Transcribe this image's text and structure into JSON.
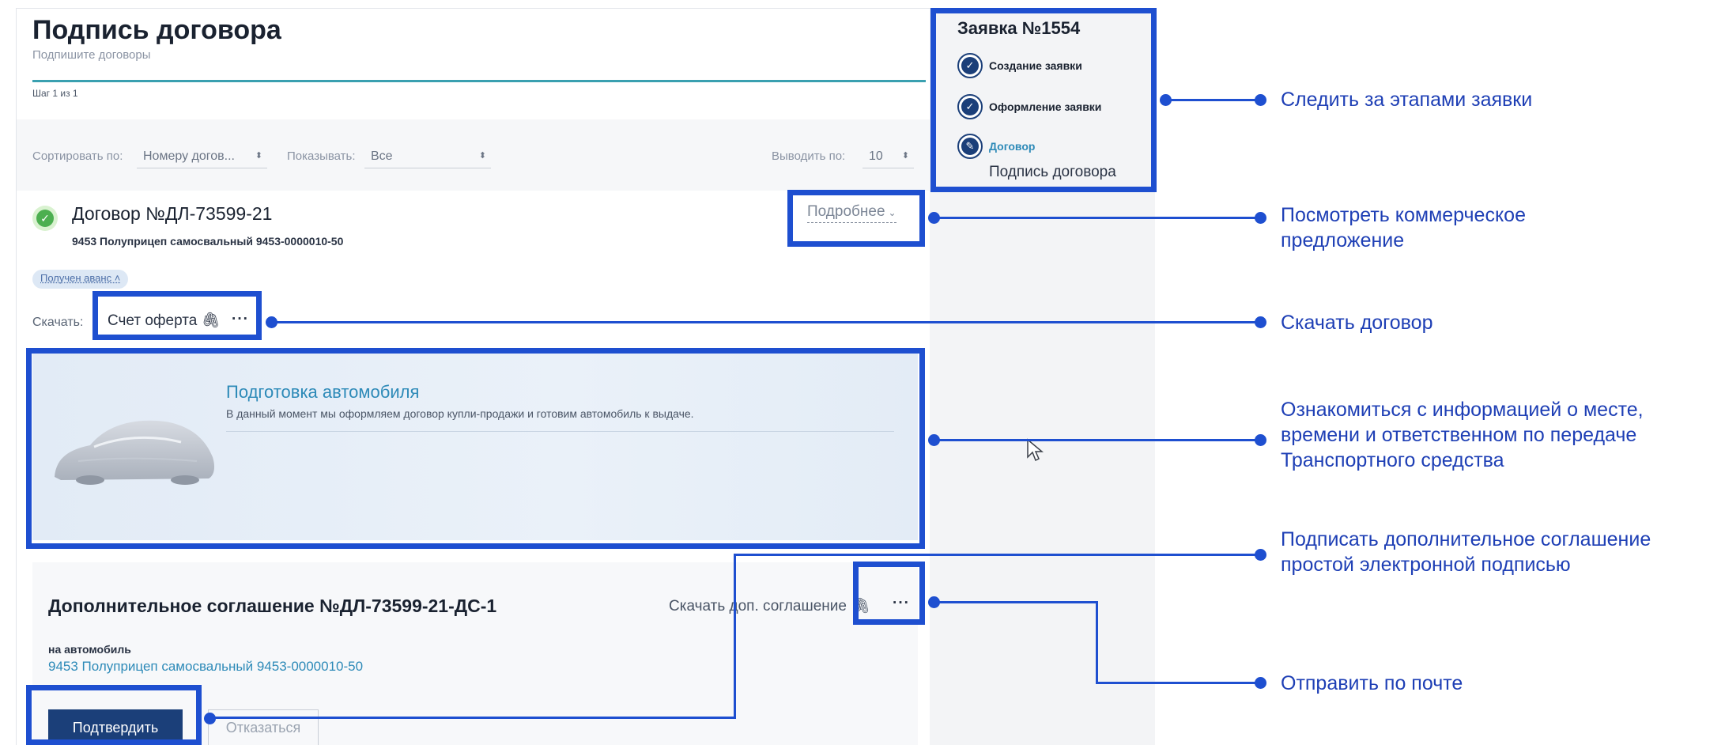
{
  "page": {
    "title": "Подпись договора",
    "subtitle": "Подпишите договоры",
    "step": "Шаг 1 из 1"
  },
  "filters": {
    "sort_label": "Сортировать по:",
    "sort_value": "Номеру догов...",
    "show_label": "Показывать:",
    "show_value": "Все",
    "per_page_label": "Выводить по:",
    "per_page_value": "10"
  },
  "contract": {
    "title": "Договор №ДЛ-73599-21",
    "subtitle": "9453 Полуприцеп самосвальный 9453-0000010-50",
    "more_link": "Подробнее",
    "badge": "Получен аванс",
    "download_label": "Скачать:",
    "download_item": "Счет оферта"
  },
  "preparation": {
    "title": "Подготовка автомобиля",
    "description": "В данный момент мы оформляем договор купли-продажи и готовим автомобиль к выдаче."
  },
  "supplement": {
    "title": "Дополнительное соглашение №ДЛ-73599-21-ДС-1",
    "download_link": "Скачать доп. соглашение",
    "for_label": "на автомобиль",
    "vehicle": "9453 Полуприцеп самосвальный 9453-0000010-50",
    "confirm_button": "Подтвердить",
    "reject_button": "Отказаться"
  },
  "aside": {
    "title": "Заявка №1554",
    "steps": [
      {
        "label": "Создание заявки",
        "state": "done"
      },
      {
        "label": "Оформление заявки",
        "state": "done"
      },
      {
        "label": "Договор",
        "state": "active"
      }
    ],
    "current_substep": "Подпись договора"
  },
  "annotations": [
    "Следить за этапами заявки",
    "Посмотреть коммерческое предложение",
    "Скачать договор",
    "Ознакомиться с информацией о месте, времени и ответственном по передаче Транспортного средства",
    "Подписать  дополнительное соглашение простой электронной подписью",
    "Отправить по почте"
  ],
  "icons": {
    "check": "check-icon",
    "chevron": "chevron-down-icon",
    "select_caret": "select-caret-icon",
    "paperclip": "paperclip-icon",
    "more": "more-dots-icon",
    "pen": "pen-icon",
    "car": "covered-car-image",
    "cursor": "mouse-cursor-icon"
  },
  "colors": {
    "annotation_blue": "#1e4fd0",
    "brand_dark": "#1b3f79",
    "link_blue": "#2d8ab8",
    "success_green": "#4caf50",
    "step_bar": "#3aa0b0"
  }
}
